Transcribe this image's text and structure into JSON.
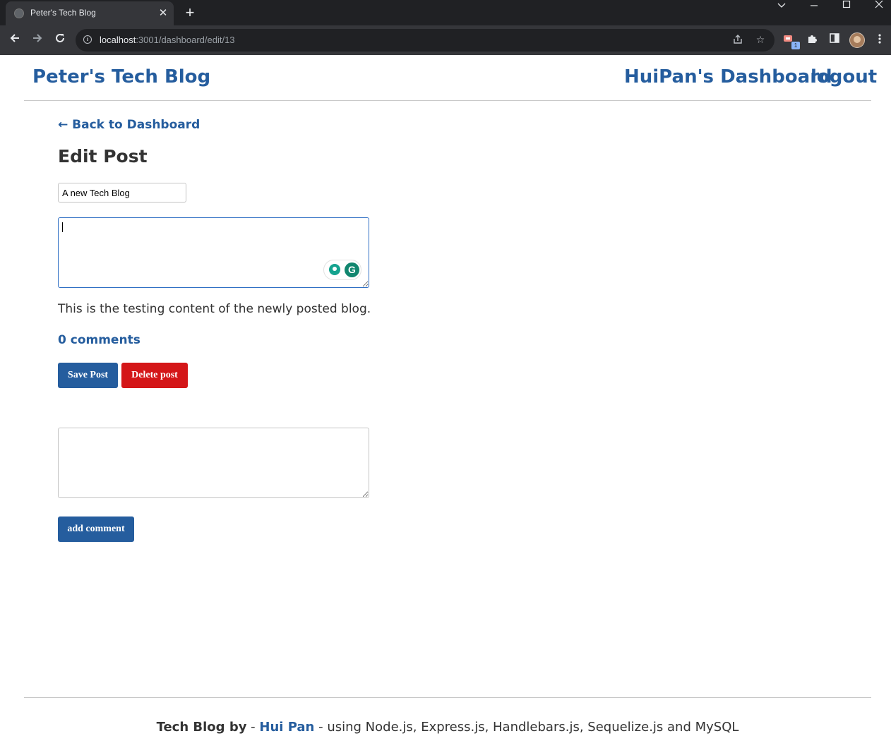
{
  "browser": {
    "tab_title": "Peter's Tech Blog",
    "tab_close_glyph": "✕",
    "new_tab_glyph": "+",
    "url_host": "localhost",
    "url_rest": ":3001/dashboard/edit/13",
    "extension_badge": "1",
    "icons": [
      "globe-icon",
      "close-icon",
      "plus-icon",
      "chevron-down-icon",
      "minimize-icon",
      "maximize-icon",
      "window-close-icon",
      "back-arrow-icon",
      "forward-arrow-icon",
      "reload-icon",
      "info-icon",
      "share-icon",
      "star-icon",
      "extension-icon",
      "puzzle-icon",
      "side-panel-icon",
      "avatar",
      "more-menu-icon"
    ]
  },
  "header": {
    "site_title": "Peter's Tech Blog",
    "dashboard_link": "HuiPan's Dashboard",
    "logout_link": "logout"
  },
  "main": {
    "back_link": "← Back to Dashboard",
    "page_title": "Edit Post",
    "title_input_value": "A new Tech Blog",
    "body_textarea_value": "",
    "post_content": "This is the testing content of the newly posted blog.",
    "comments_count": "0 comments",
    "save_button": "Save Post",
    "delete_button": "Delete post",
    "comment_textarea_value": "",
    "add_comment_button": "add comment",
    "grammarly_letter": "G"
  },
  "footer": {
    "brand": "Tech Blog by",
    "sep1": " - ",
    "author": "Hui Pan",
    "rest": " - using Node.js, Express.js, Handlebars.js, Sequelize.js and MySQL"
  },
  "colors": {
    "brand_blue": "#255d9e",
    "delete_red": "#d41618",
    "text_dark": "#333333",
    "chrome_dark": "#202124"
  }
}
